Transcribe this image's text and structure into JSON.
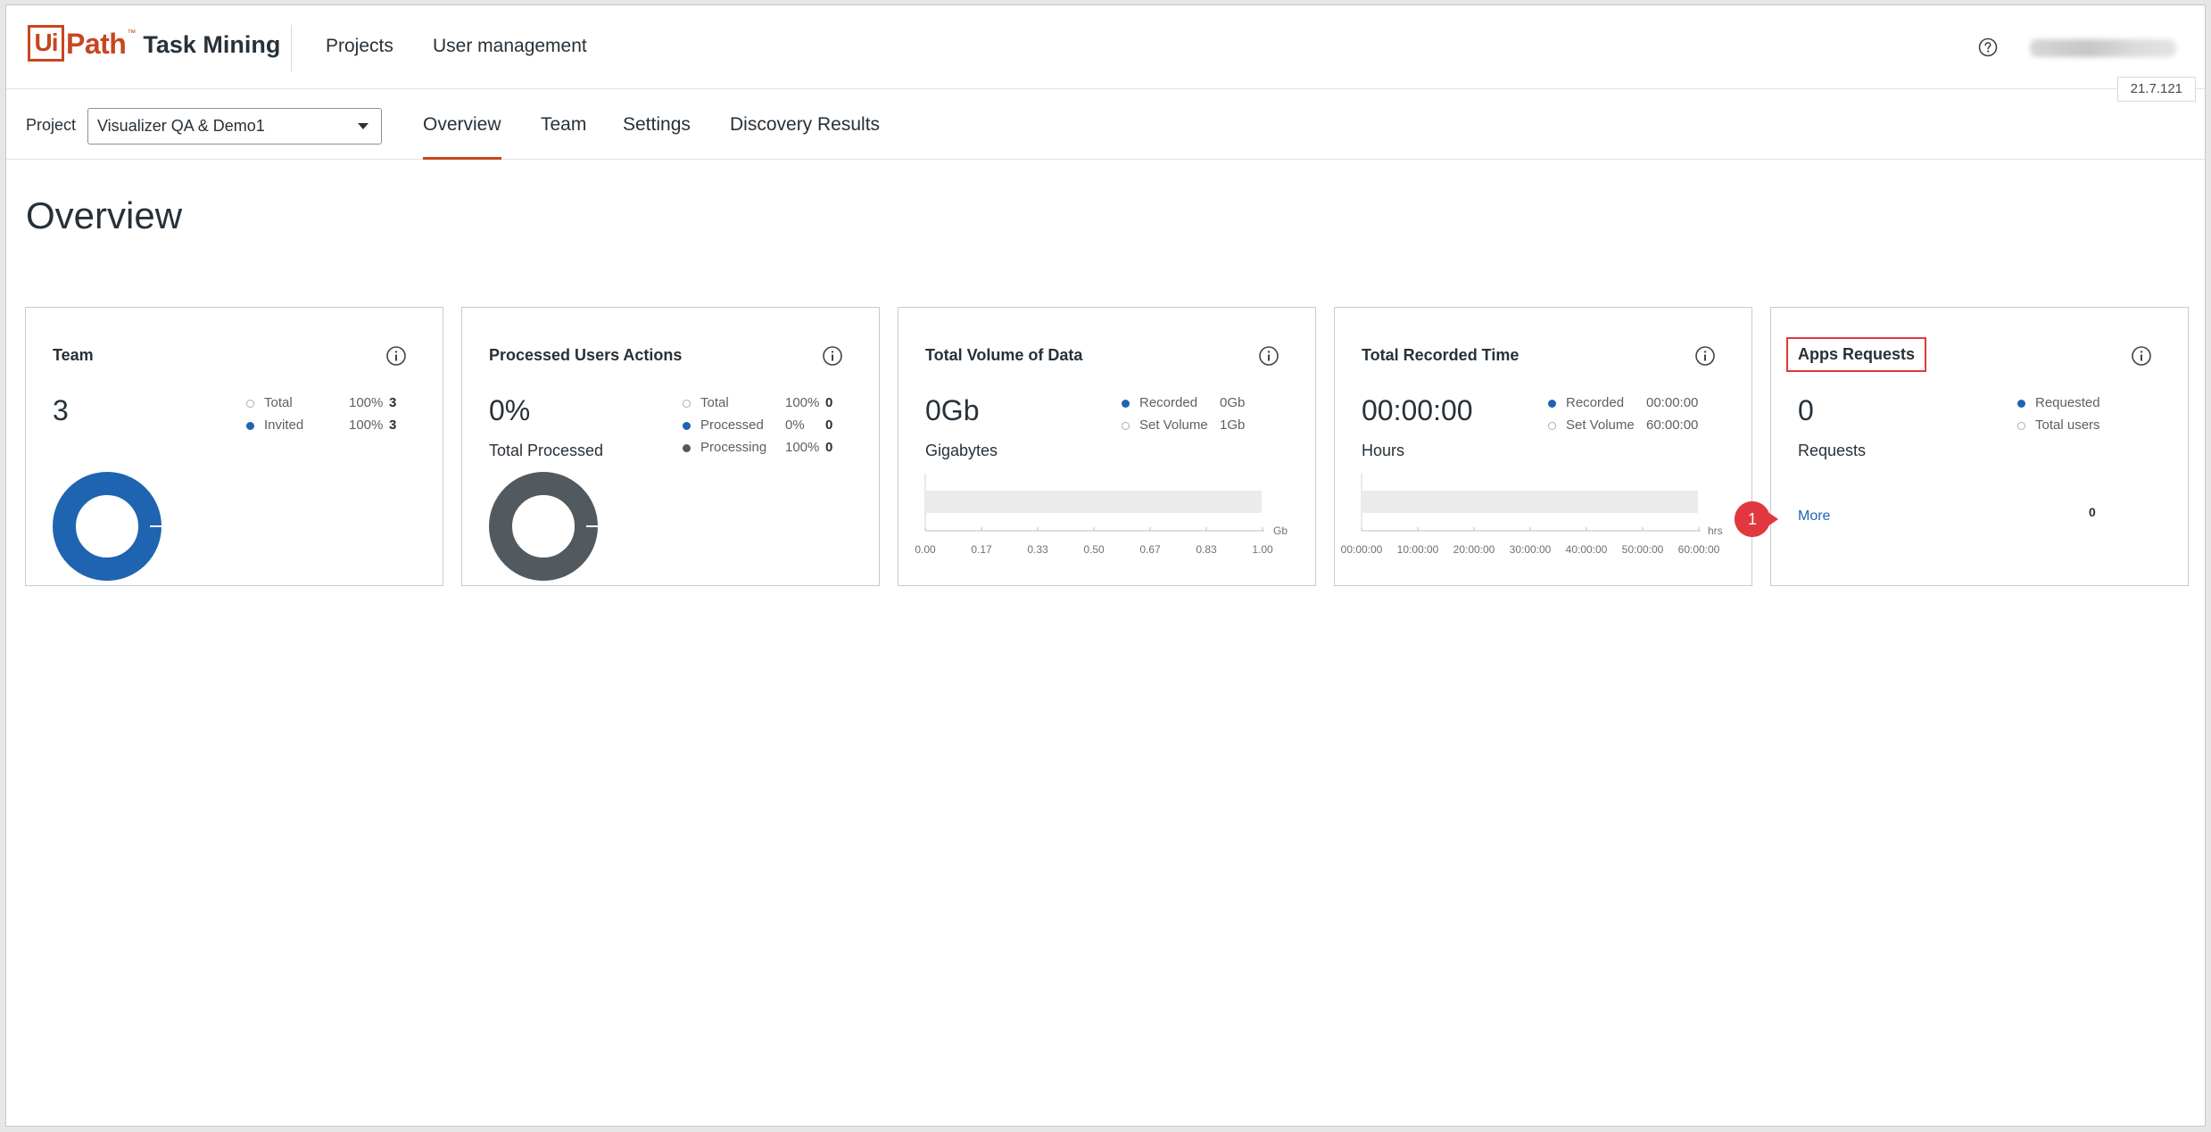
{
  "header": {
    "logo_ui": "Ui",
    "logo_path": "Path",
    "logo_tm": "™",
    "product": "Task Mining",
    "nav": [
      "Projects",
      "User management"
    ],
    "help_icon": "question-circle-icon",
    "version": "21.7.121"
  },
  "subnav": {
    "project_label": "Project",
    "project_value": "Visualizer QA & Demo1",
    "tabs": [
      "Overview",
      "Team",
      "Settings",
      "Discovery Results"
    ],
    "active_tab": "Overview"
  },
  "page": {
    "title": "Overview"
  },
  "cards": {
    "team": {
      "title": "Team",
      "value": "3",
      "legend": [
        {
          "name": "Total",
          "pct": "100%",
          "num": "3"
        },
        {
          "name": "Invited",
          "pct": "100%",
          "num": "3"
        }
      ],
      "donut_fraction": 1.0,
      "color": "#1f64b0"
    },
    "processed": {
      "title": "Processed Users Actions",
      "value": "0%",
      "sub_label": "Total Processed",
      "legend": [
        {
          "name": "Total",
          "pct": "100%",
          "num": "0"
        },
        {
          "name": "Processed",
          "pct": "0%",
          "num": "0"
        },
        {
          "name": "Processing",
          "pct": "100%",
          "num": "0"
        }
      ],
      "donut_fraction": 1.0,
      "color": "#525a60"
    },
    "volume": {
      "title": "Total Volume of Data",
      "value": "0Gb",
      "sub_label": "Gigabytes",
      "legend": [
        {
          "name": "Recorded",
          "val": "0Gb"
        },
        {
          "name": "Set Volume",
          "val": "1Gb"
        }
      ],
      "ticks": [
        "0.00",
        "0.17",
        "0.33",
        "0.50",
        "0.67",
        "0.83",
        "1.00"
      ],
      "unit": "Gb"
    },
    "time": {
      "title": "Total Recorded Time",
      "value": "00:00:00",
      "sub_label": "Hours",
      "legend": [
        {
          "name": "Recorded",
          "val": "00:00:00"
        },
        {
          "name": "Set Volume",
          "val": "60:00:00"
        }
      ],
      "ticks": [
        "00:00:00",
        "10:00:00",
        "20:00:00",
        "30:00:00",
        "40:00:00",
        "50:00:00",
        "60:00:00"
      ],
      "unit": "hrs"
    },
    "apps": {
      "title": "Apps Requests",
      "value": "0",
      "sub_label": "Requests",
      "legend": [
        {
          "name": "Requested"
        },
        {
          "name": "Total users"
        }
      ],
      "more": "More",
      "zero": "0",
      "badge": "1"
    }
  },
  "colors": {
    "accent": "#c6471f",
    "blue": "#1f64b0",
    "dark_gray": "#525a60",
    "highlight": "#e0383e"
  }
}
